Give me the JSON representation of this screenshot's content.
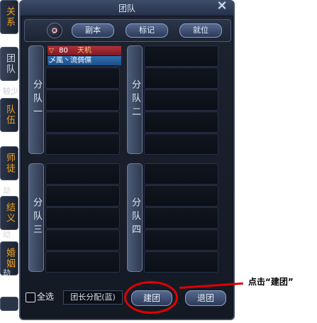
{
  "side_tabs": {
    "relation": "关系",
    "team": "团队",
    "team_word": "较少",
    "squad": "队伍",
    "mentor": "师徒",
    "jie1": "劫",
    "sworn": "结义",
    "jie2": "劫",
    "marriage": "婚姻",
    "jie3": "劫"
  },
  "panel": {
    "title": "团队",
    "toolbar": {
      "dungeon": "副本",
      "mark": "标记",
      "ready": "就位"
    }
  },
  "squads": [
    {
      "label": "分队一"
    },
    {
      "label": "分队二"
    },
    {
      "label": "分队三"
    },
    {
      "label": "分队四"
    }
  ],
  "member": {
    "level": "80",
    "class": "天机",
    "name": "乄風丶流倜儻"
  },
  "bottom": {
    "select_all": "全选",
    "assign": "团长分配(蓝)",
    "create": "建团",
    "leave": "退团"
  },
  "annotation": "点击“建团”",
  "colors": {
    "accent_red": "#e00000",
    "class_text": "#ffd070"
  }
}
